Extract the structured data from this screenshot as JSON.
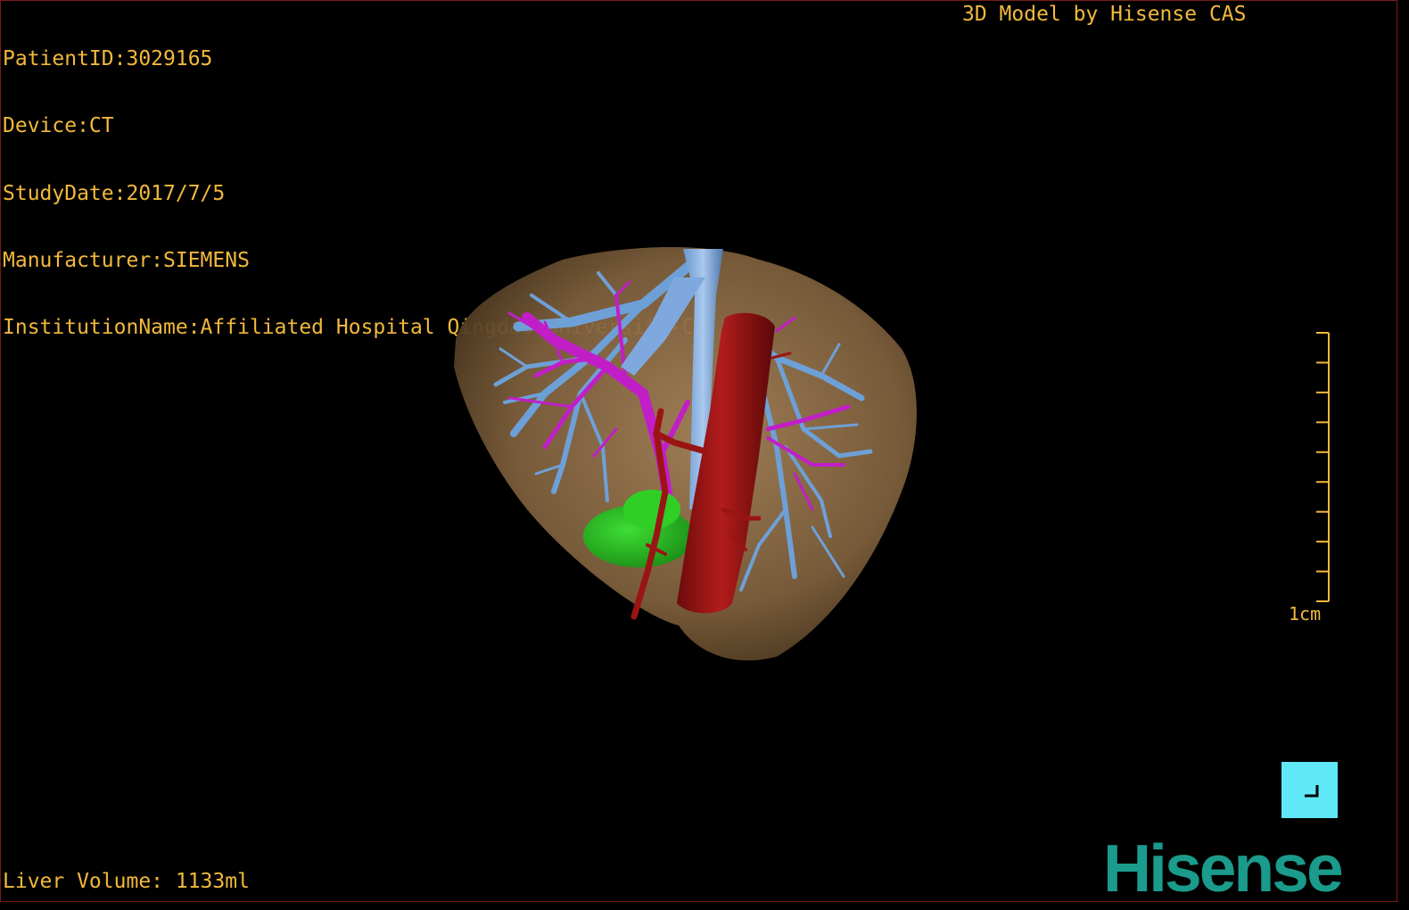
{
  "header": {
    "patient_id": "PatientID:3029165",
    "device": "Device:CT",
    "study_date": "StudyDate:2017/7/5",
    "manufacturer": "Manufacturer:SIEMENS",
    "institution": "InstitutionName:Affiliated Hospital Qingdao University-C",
    "credit": "3D Model by Hisense CAS"
  },
  "footer": {
    "liver_volume": "Liver Volume: 1133ml"
  },
  "scale": {
    "label": "1cm",
    "ticks": 10
  },
  "brand": {
    "logo_text": "Hisense",
    "color": "#1a9b8c"
  },
  "colors": {
    "overlay_text": "#f2b93b",
    "liver": "#8a6a45",
    "hepatic_vein": "#6ea0d8",
    "portal_vein": "#c21ec8",
    "artery_ivc": "#9b1414",
    "gallbladder": "#27b41f",
    "corner_button": "#5fe8f6"
  },
  "icons": {
    "corner_button": "corner-bracket-icon"
  }
}
